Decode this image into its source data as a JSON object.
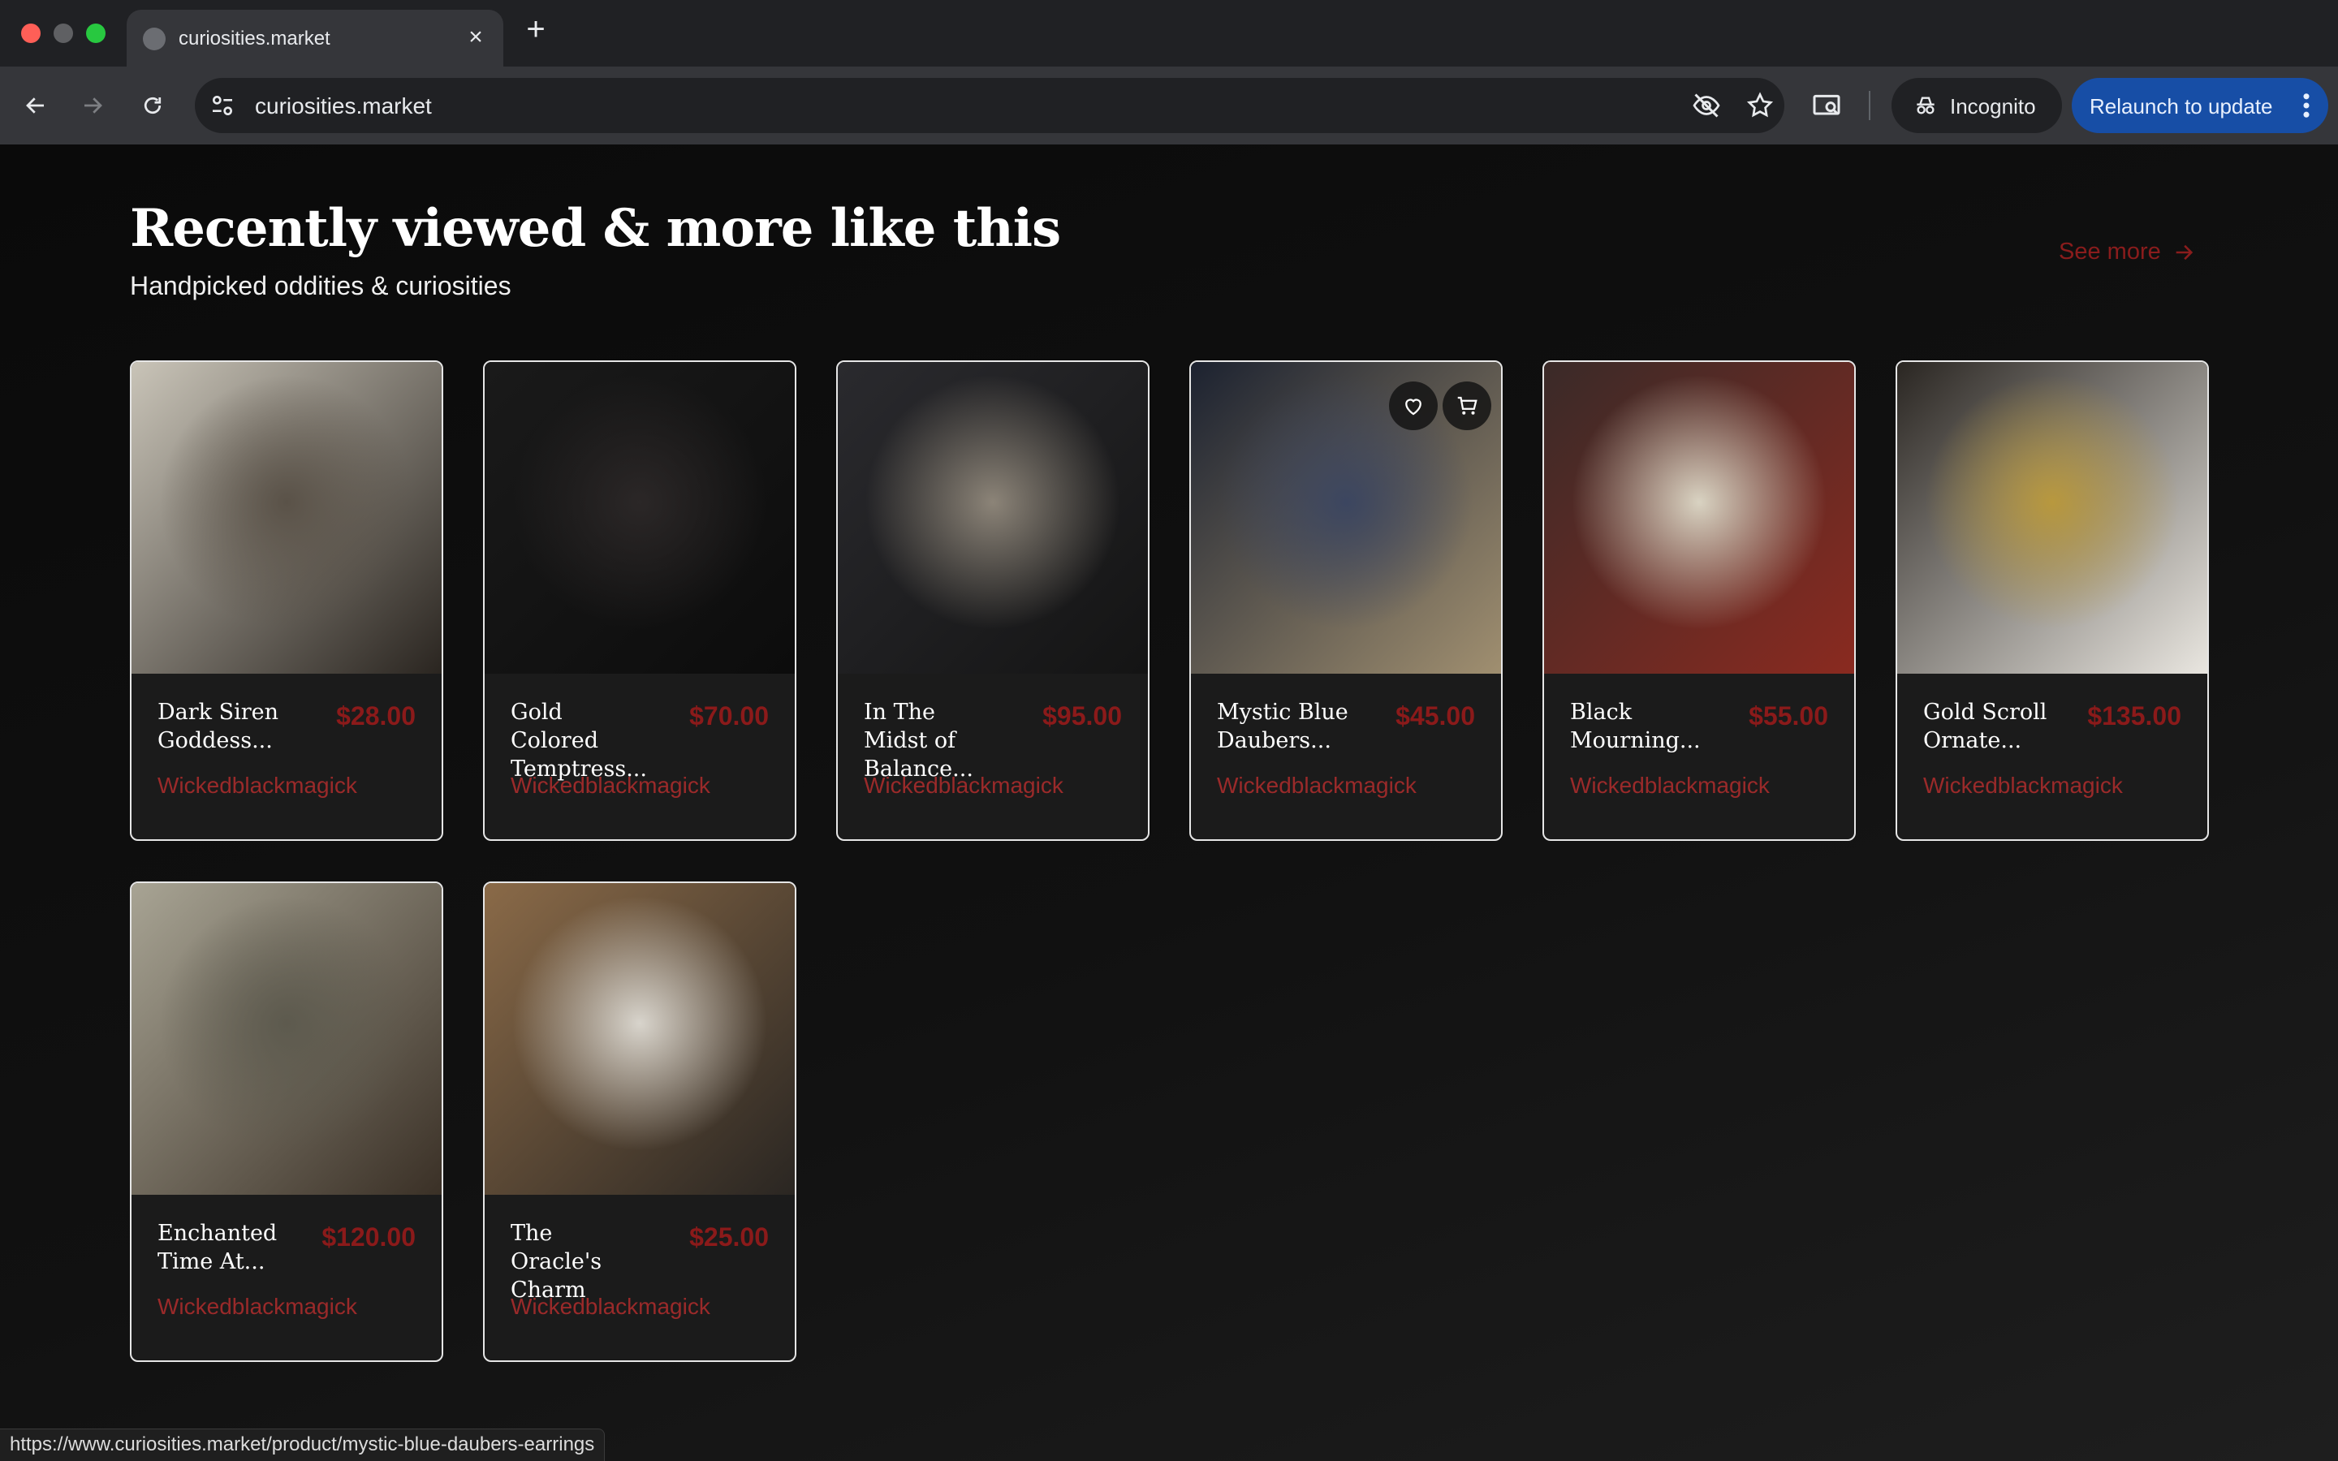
{
  "browser": {
    "tab_title": "curiosities.market",
    "url": "curiosities.market",
    "incognito_label": "Incognito",
    "relaunch_label": "Relaunch to update",
    "status_url": "https://www.curiosities.market/product/mystic-blue-daubers-earrings"
  },
  "section": {
    "title": "Recently viewed & more like this",
    "subtitle": "Handpicked oddities & curiosities",
    "see_more": "See more"
  },
  "products": [
    {
      "name": "Dark Siren Goddess...",
      "price": "$28.00",
      "seller": "Wickedblackmagick",
      "palette": [
        "#c9c4b8",
        "#5a5248",
        "#2a2520"
      ]
    },
    {
      "name": "Gold Colored Temptress...",
      "price": "$70.00",
      "seller": "Wickedblackmagick",
      "palette": [
        "#1a1a1a",
        "#2b2727",
        "#0c0c0c"
      ]
    },
    {
      "name": "In The Midst of Balance...",
      "price": "$95.00",
      "seller": "Wickedblackmagick",
      "palette": [
        "#2a2a2e",
        "#8c8478",
        "#141414"
      ]
    },
    {
      "name": "Mystic Blue Daubers...",
      "price": "$45.00",
      "seller": "Wickedblackmagick",
      "palette": [
        "#1c2230",
        "#3c4660",
        "#a08f70"
      ]
    },
    {
      "name": "Black Mourning...",
      "price": "$55.00",
      "seller": "Wickedblackmagick",
      "palette": [
        "#3a2a28",
        "#d9d3c2",
        "#8a2a20"
      ]
    },
    {
      "name": "Gold Scroll Ornate...",
      "price": "$135.00",
      "seller": "Wickedblackmagick",
      "palette": [
        "#2a2622",
        "#b8983e",
        "#e9e6e0"
      ]
    },
    {
      "name": "Enchanted Time At...",
      "price": "$120.00",
      "seller": "Wickedblackmagick",
      "palette": [
        "#a8a494",
        "#5d5a4e",
        "#3a3026"
      ]
    },
    {
      "name": "The Oracle's Charm",
      "price": "$25.00",
      "seller": "Wickedblackmagick",
      "palette": [
        "#8a6a48",
        "#d8d4cc",
        "#2a2622"
      ]
    }
  ],
  "hovered_card_index": 3,
  "icons": {
    "back": "arrow-left-icon",
    "forward": "arrow-right-icon",
    "reload": "reload-icon",
    "site_info": "tune-icon",
    "tracking": "eye-off-icon",
    "bookmark": "star-icon",
    "lens": "lens-icon",
    "incognito": "incognito-icon",
    "menu": "kebab-menu-icon",
    "wishlist": "heart-icon",
    "cart": "cart-icon"
  }
}
